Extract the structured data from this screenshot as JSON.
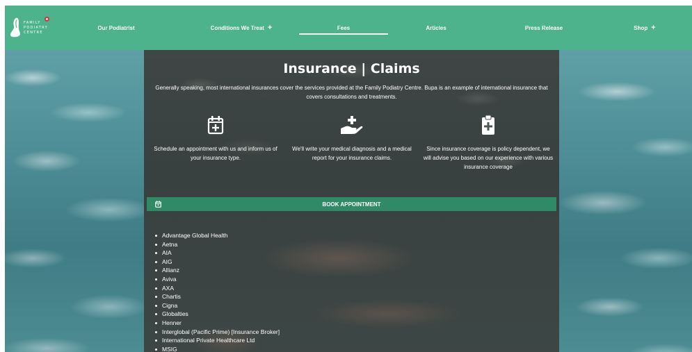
{
  "brand": {
    "logo_lines": [
      "FAMILY",
      "PODIATRY",
      "CENTRE"
    ],
    "colors": {
      "nav": "#4db38c",
      "button": "#2f8a67",
      "accent_dot": "#d9303c"
    }
  },
  "nav": {
    "items": [
      {
        "label": "Our Podiatrist",
        "has_submenu": false
      },
      {
        "label": "Conditions We Treat",
        "has_submenu": true
      },
      {
        "label": "Fees",
        "has_submenu": false,
        "active": true
      },
      {
        "label": "Articles",
        "has_submenu": false
      },
      {
        "label": "Press Release",
        "has_submenu": false
      },
      {
        "label": "Shop",
        "has_submenu": true
      }
    ],
    "submenu_glyph": "+"
  },
  "main": {
    "title": "Insurance | Claims",
    "intro": "Generally speaking, most international insurances cover the services provided at the Family Podiatry Centre. Bupa is an example of international insurance that covers consultations and treatments.",
    "steps": [
      {
        "icon": "calendar-plus-icon",
        "text": "Schedule an appointment with us and inform us of your insurance type."
      },
      {
        "icon": "hand-holding-medical-icon",
        "text": "We'll write your medical diagnosis and a medical report for your insurance claims."
      },
      {
        "icon": "clipboard-medical-icon",
        "text": "Since insurance coverage is policy dependent, we will advise you based on our experience with various insurance coverage"
      }
    ],
    "book_button": {
      "label": "BOOK APPOINTMENT",
      "icon": "calendar-icon"
    },
    "insurers": [
      "Advantage Global Health",
      "Aetna",
      "AIA",
      "AIG",
      "Allianz",
      "Aviva",
      "AXA",
      "Chartis",
      "Cigna",
      "Globalties",
      "Henner",
      "Interglobal (Pacific Prime) [Insurance Broker]",
      "International Private Healthcare Ltd",
      "MSIG"
    ]
  }
}
